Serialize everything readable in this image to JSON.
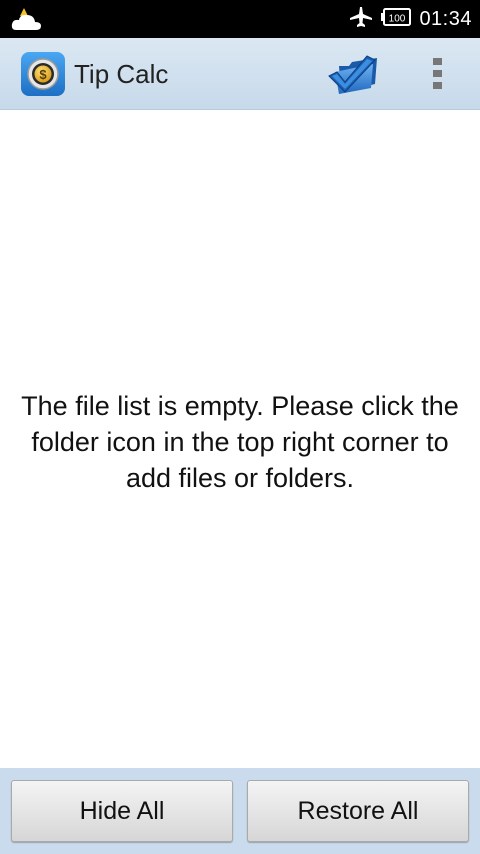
{
  "status_bar": {
    "time": "01:34",
    "battery_level": "100",
    "icons": [
      "weather-cloud-sun-icon",
      "airplane-mode-icon",
      "battery-icon"
    ]
  },
  "action_bar": {
    "app_title": "Tip Calc",
    "app_icon": "dollar-coin-icon",
    "folder_icon": "folder-check-icon",
    "overflow_icon": "overflow-menu-icon"
  },
  "main": {
    "empty_message": "The file list is empty. Please click the folder icon in the top right corner to add files or folders."
  },
  "bottom_bar": {
    "hide_all_label": "Hide All",
    "restore_all_label": "Restore All"
  },
  "colors": {
    "action_bar": "#c7d9ea",
    "bottom_bar": "#c9dbec",
    "folder_blue": "#2f7fd3"
  }
}
